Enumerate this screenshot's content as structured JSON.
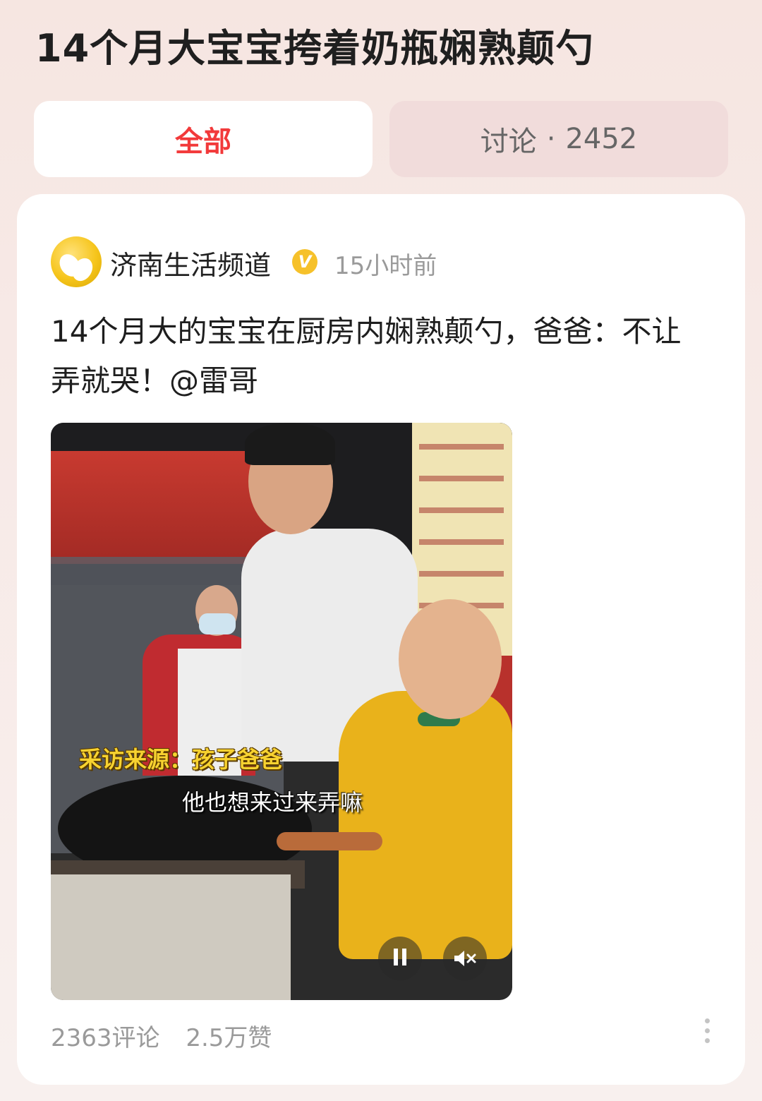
{
  "topic": {
    "title": "14个月大宝宝挎着奶瓶娴熟颠勺"
  },
  "tabs": [
    {
      "label": "全部",
      "active": true
    },
    {
      "label": "讨论",
      "separator": "·",
      "count": "2452",
      "active": false
    }
  ],
  "post": {
    "author": "济南生活频道",
    "verified_mark": "V",
    "time": "15小时前",
    "text": "14个月大的宝宝在厨房内娴熟颠勺，爸爸：不让弄就哭！@雷哥",
    "video": {
      "caption_source": "采访来源：孩子爸爸",
      "caption_subtitle": "他也想来过来弄嘛",
      "controls": {
        "pause_icon": "pause-icon",
        "mute_icon": "mute-icon"
      }
    },
    "stats": {
      "comments": "2363评论",
      "likes": "2.5万赞"
    }
  },
  "colors": {
    "accent": "#f2393a",
    "verified": "#f6c12a",
    "muted_text": "#9a9a9a"
  }
}
